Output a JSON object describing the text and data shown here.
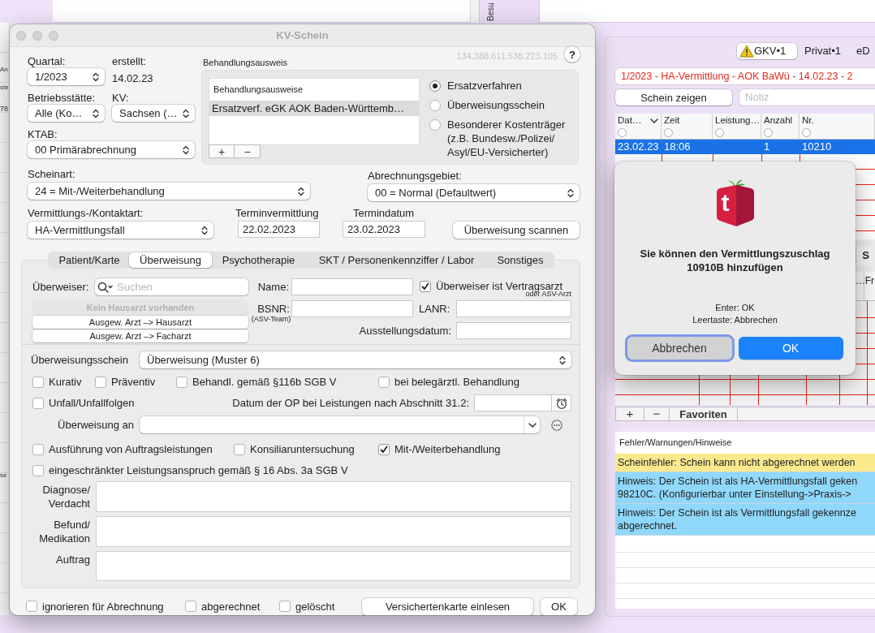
{
  "desktop": {
    "sidebar_fragments": [
      "An",
      "ste",
      "78",
      "se"
    ],
    "top_tab": "Besu"
  },
  "dialog": {
    "title": "KV-Schein",
    "quarter": {
      "label": "Quartal:",
      "value": "1/2023"
    },
    "created": {
      "label": "erstellt:",
      "value": "14.02.23"
    },
    "site": {
      "label": "Betriebsstätte:",
      "value": "Alle (Ko…"
    },
    "kv": {
      "label": "KV:",
      "value": "Sachsen (…"
    },
    "ktab": {
      "label": "KTAB:",
      "value": "00 Primärabrechnung"
    },
    "card_group": {
      "title": "Behandlungsausweis",
      "list_header": "Behandlungsausweise",
      "items": [
        {
          "text": "Ersatzverf. eGK AOK Baden-Württemb…",
          "selected": true
        }
      ],
      "buttons": [
        "+",
        "−"
      ]
    },
    "version": "134.388.611.538.223.105",
    "help": "?",
    "card_modes": [
      {
        "lines": [
          "Ersatzverfahren"
        ],
        "selected": true
      },
      {
        "lines": [
          "Überweisungsschein"
        ],
        "selected": false
      },
      {
        "lines": [
          "Besonderer Kostenträger",
          "(z.B. Bundesw./Polizei/",
          "Asyl/EU-Versicherter)"
        ],
        "selected": false
      }
    ],
    "certificate_type": {
      "label": "Scheinart:",
      "value": "24 = Mit-/Weiterbehandlung"
    },
    "billing_area": {
      "label": "Abrechnungsgebiet:",
      "value": "00 = Normal (Defaultwert)"
    },
    "contact_type": {
      "label": "Vermittlungs-/Kontaktart:",
      "value": "HA-Vermittlungsfall"
    },
    "appointment_referral": {
      "label": "Terminvermittlung",
      "value": "22.02.2023"
    },
    "appointment_date": {
      "label": "Termindatum",
      "value": "23.02.2023"
    },
    "scan_button": "Überweisung scannen",
    "tabs": [
      {
        "label": "Patient/Karte",
        "selected": false
      },
      {
        "label": "Überweisung",
        "selected": true
      },
      {
        "label": "Psychotherapie",
        "selected": false
      },
      {
        "label": "SKT / Personenkennziffer / Labor",
        "selected": false
      },
      {
        "label": "Sonstiges",
        "selected": false
      }
    ],
    "referral": {
      "referrer_label": "Überweiser:",
      "search_placeholder": "Suchen",
      "doctor_buttons": [
        {
          "label": "Kein Hausarzt vorhanden",
          "disabled": true
        },
        {
          "label": "Ausgew. Arzt –> Hausarzt",
          "disabled": false
        },
        {
          "label": "Ausgew. Arzt –> Facharzt",
          "disabled": false
        }
      ],
      "name_label": "Name:",
      "contract_doctor": {
        "label": "Überweiser ist Vertragsarzt",
        "checked": true
      },
      "contract_doctor_note": "oder ASV-Arzt",
      "bsnr_label": "BSNR:",
      "bsnr_note": "(ASV-Team)",
      "lanr_label": "LANR:",
      "issue_date_label": "Ausstellungsdatum:",
      "form": {
        "label": "Überweisungsschein",
        "value": "Überweisung (Muster 6)"
      },
      "options_row_1": [
        {
          "label": "Kurativ",
          "checked": false
        },
        {
          "label": "Präventiv",
          "checked": false
        },
        {
          "label": "Behandl. gemäß §116b SGB V",
          "checked": false
        },
        {
          "label": "bei belegärztl. Behandlung",
          "checked": false
        }
      ],
      "accident": {
        "label": "Unfall/Unfallfolgen",
        "checked": false
      },
      "op_date_label": "Datum der OP bei Leistungen nach Abschnitt 31.2:",
      "referral_to_label": "Überweisung an",
      "options_row_2": [
        {
          "label": "Ausführung von Auftragsleistungen",
          "checked": false
        },
        {
          "label": "Konsiliaruntersuchung",
          "checked": false
        },
        {
          "label": "Mit-/Weiterbehandlung",
          "checked": true
        }
      ],
      "options_row_3": [
        {
          "label": "eingeschränkter Leistungsanspruch gemäß § 16 Abs. 3a SGB V",
          "checked": false
        }
      ],
      "text_areas": [
        {
          "label_lines": [
            "Diagnose/",
            "Verdacht"
          ]
        },
        {
          "label_lines": [
            "Befund/",
            "Medikation"
          ]
        },
        {
          "label_lines": [
            "Auftrag"
          ]
        }
      ]
    },
    "footer": {
      "checkboxes": [
        {
          "label": "ignorieren für Abrechnung",
          "checked": false
        },
        {
          "label": "abgerechnet",
          "checked": false
        },
        {
          "label": "gelöscht",
          "checked": false
        }
      ],
      "buttons": [
        "Versichertenkarte einlesen",
        "OK"
      ]
    }
  },
  "side": {
    "tabs": [
      {
        "label": "GKV•1",
        "selected": true,
        "warning": true
      },
      {
        "label": "Privat•1",
        "selected": false,
        "warning": false
      },
      {
        "label": "eD",
        "selected": false,
        "warning": false
      }
    ],
    "case_title": "1/2023 - HA-Vermittlung - AOK BaWü - 14.02.23 - 2",
    "show_button": "Schein zeigen",
    "note_placeholder": "Notiz",
    "columns": [
      "Dat…",
      "Zeit",
      "Leistung…",
      "Anzahl",
      "Nr."
    ],
    "rows": [
      {
        "date": "23.02.23",
        "time": "18:06",
        "count": "1",
        "number": "10210",
        "selected": true
      }
    ],
    "lower_panel": {
      "tab_fragment": "S",
      "column_fragments": [
        "…",
        "Fr"
      ]
    },
    "footer_buttons": [
      "+",
      "−"
    ],
    "favorites_tab": "Favoriten",
    "messages": {
      "title": "Fehler/Warnungen/Hinweise",
      "items": [
        {
          "kind": "error",
          "lines": [
            "Scheinfehler: Schein kann nicht abgerechnet werden"
          ]
        },
        {
          "kind": "hint",
          "lines": [
            "Hinweis: Der Schein ist als HA-Vermittlungsfall geken",
            "98210C. (Konfigurierbar unter Einstellung->Praxis->"
          ]
        },
        {
          "kind": "hint",
          "lines": [
            "Hinweis: Der Schein ist als Vermittlungsfall gekennze",
            "abgerechnet."
          ]
        }
      ]
    }
  },
  "alert": {
    "logo_text": "t",
    "message": "Sie können den Vermittlungszuschlag 10910B hinzufügen",
    "shortcuts": [
      "Enter: OK",
      "Leertaste: Abbrechen"
    ],
    "buttons": [
      {
        "label": "Abbrechen",
        "kind": "cancel",
        "focused": true
      },
      {
        "label": "OK",
        "kind": "default",
        "focused": false
      }
    ]
  }
}
